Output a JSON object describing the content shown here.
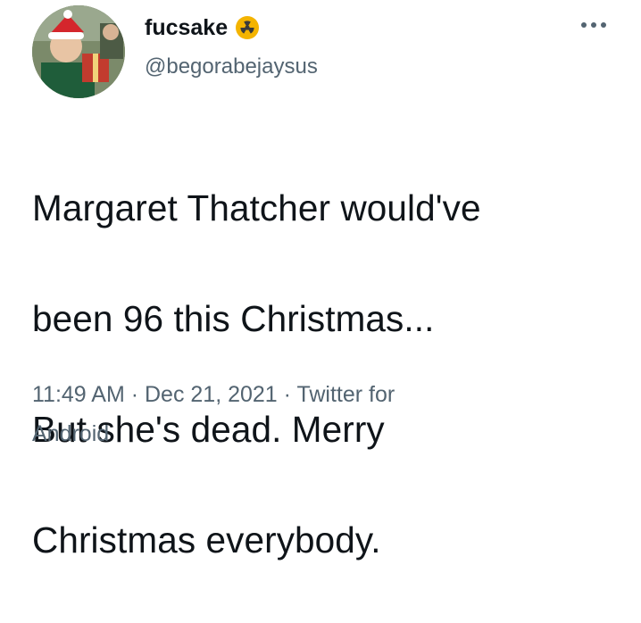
{
  "user": {
    "display_name": "fucsake",
    "handle": "@begorabejaysus",
    "badge_icon": "radioactive-icon",
    "avatar_icon": "avatar-image"
  },
  "tweet": {
    "text_lines": [
      "Margaret Thatcher would've",
      "been 96 this Christmas...",
      "But she's dead. Merry",
      "Christmas everybody."
    ],
    "meta_line1": "11:49 AM · Dec 21, 2021 · Twitter for",
    "meta_line2": "Android"
  },
  "icons": {
    "more": "more-horizontal-icon"
  },
  "colors": {
    "text": "#0f1419",
    "secondary": "#536471",
    "badge": "#f4b400"
  }
}
